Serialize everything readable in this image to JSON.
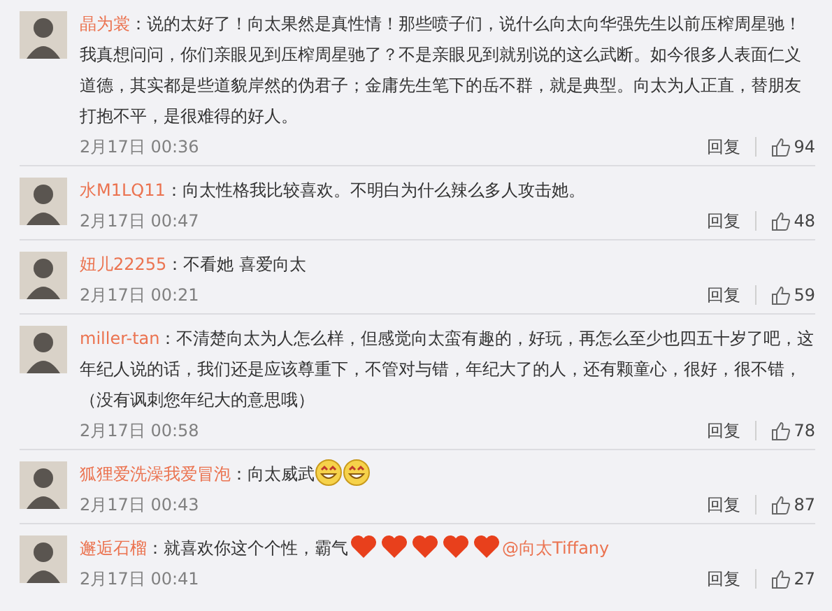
{
  "comments": [
    {
      "user": "晶为裳",
      "parts": [
        {
          "kind": "text",
          "text": "：说的太好了！向太果然是真性情！那些喷子们，说什么向太向华强先生以前压榨周星驰！我真想问问，你们亲眼见到压榨周星驰了？不是亲眼见到就别说的这么武断。如今很多人表面仁义道德，其实都是些道貌岸然的伪君子；金庸先生笔下的岳不群，就是典型。向太为人正直，替朋友打抱不平，是很难得的好人。"
        }
      ],
      "time": "2月17日 00:36",
      "reply": "回复",
      "likes": "94"
    },
    {
      "user": "水M1LQ11",
      "parts": [
        {
          "kind": "text",
          "text": "：向太性格我比较喜欢。不明白为什么辣么多人攻击她。"
        }
      ],
      "time": "2月17日 00:47",
      "reply": "回复",
      "likes": "48"
    },
    {
      "user": "妞儿22255",
      "parts": [
        {
          "kind": "text",
          "text": "：不看她 喜爱向太"
        }
      ],
      "time": "2月17日 00:21",
      "reply": "回复",
      "likes": "59"
    },
    {
      "user": "miller-tan",
      "parts": [
        {
          "kind": "text",
          "text": "：不清楚向太为人怎么样，但感觉向太蛮有趣的，好玩，再怎么至少也四五十岁了吧，这年纪人说的话，我们还是应该尊重下，不管对与错，年纪大了的人，还有颗童心，很好，很不错，（没有讽刺您年纪大的意思哦）"
        }
      ],
      "time": "2月17日 00:58",
      "reply": "回复",
      "likes": "78"
    },
    {
      "user": "狐狸爱洗澡我爱冒泡",
      "parts": [
        {
          "kind": "text",
          "text": "：向太威武"
        },
        {
          "kind": "smiley"
        },
        {
          "kind": "smiley"
        }
      ],
      "time": "2月17日 00:43",
      "reply": "回复",
      "likes": "87"
    },
    {
      "user": "邂逅石榴",
      "parts": [
        {
          "kind": "text",
          "text": "：就喜欢你这个个性，霸气"
        },
        {
          "kind": "heart"
        },
        {
          "kind": "heart"
        },
        {
          "kind": "heart"
        },
        {
          "kind": "heart"
        },
        {
          "kind": "heart"
        },
        {
          "kind": "mention",
          "text": "@向太Tiffany"
        }
      ],
      "time": "2月17日 00:41",
      "reply": "回复",
      "likes": "27"
    }
  ]
}
